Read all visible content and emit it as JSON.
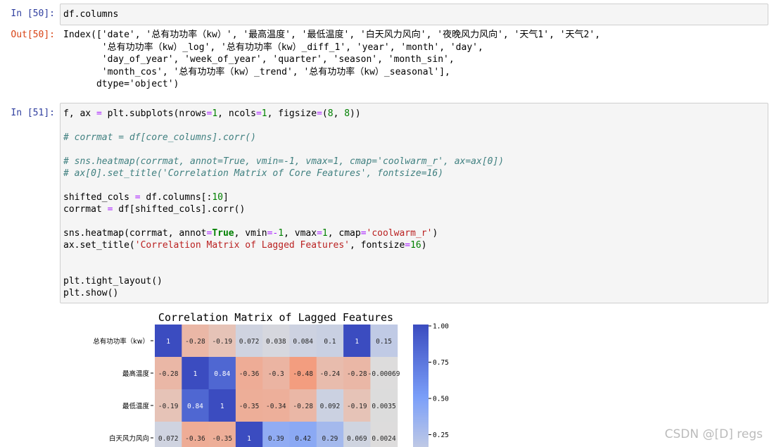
{
  "cells": [
    {
      "prompt": "In  [50]:",
      "code": [
        [
          [
            "df.columns",
            ""
          ]
        ]
      ]
    },
    {
      "prompt": "Out[50]:",
      "output": [
        "Index(['date', '总有功功率（kw）', '最高温度', '最低温度', '白天风力风向', '夜晚风力风向', '天气1', '天气2',",
        "       '总有功功率（kw）_log', '总有功功率（kw）_diff_1', 'year', 'month', 'day',",
        "       'day_of_year', 'week_of_year', 'quarter', 'season', 'month_sin',",
        "       'month_cos', '总有功功率（kw）_trend', '总有功功率（kw）_seasonal'],",
        "      dtype='object')"
      ]
    },
    {
      "prompt": "In  [51]:",
      "code": [
        [
          [
            "f, ax ",
            ""
          ],
          [
            "=",
            "op"
          ],
          [
            " plt.subplots(nrows",
            ""
          ],
          [
            "=",
            "op"
          ],
          [
            "1",
            "num"
          ],
          [
            ", ncols",
            ""
          ],
          [
            "=",
            "op"
          ],
          [
            "1",
            "num"
          ],
          [
            ", figsize",
            ""
          ],
          [
            "=",
            "op"
          ],
          [
            "(",
            ""
          ],
          [
            "8",
            "num"
          ],
          [
            ", ",
            ""
          ],
          [
            "8",
            "num"
          ],
          [
            "))",
            ""
          ]
        ],
        [],
        [
          [
            "# corrmat = df[core_columns].corr()",
            "cm"
          ]
        ],
        [],
        [
          [
            "# sns.heatmap(corrmat, annot=True, vmin=-1, vmax=1, cmap='coolwarm_r', ax=ax[0])",
            "cm"
          ]
        ],
        [
          [
            "# ax[0].set_title('Correlation Matrix of Core Features', fontsize=16)",
            "cm"
          ]
        ],
        [],
        [
          [
            "shifted_cols ",
            ""
          ],
          [
            "=",
            "op"
          ],
          [
            " df.columns[:",
            ""
          ],
          [
            "10",
            "num"
          ],
          [
            "]",
            ""
          ]
        ],
        [
          [
            "corrmat ",
            ""
          ],
          [
            "=",
            "op"
          ],
          [
            " df[shifted_cols].corr()",
            ""
          ]
        ],
        [],
        [
          [
            "sns.heatmap(corrmat, annot",
            ""
          ],
          [
            "=",
            "op"
          ],
          [
            "True",
            "kw"
          ],
          [
            ", vmin",
            ""
          ],
          [
            "=-",
            "op"
          ],
          [
            "1",
            "num"
          ],
          [
            ", vmax",
            ""
          ],
          [
            "=",
            "op"
          ],
          [
            "1",
            "num"
          ],
          [
            ", cmap",
            ""
          ],
          [
            "=",
            "op"
          ],
          [
            "'coolwarm_r'",
            "str"
          ],
          [
            ")",
            ""
          ]
        ],
        [
          [
            "ax.set_title(",
            ""
          ],
          [
            "'Correlation Matrix of Lagged Features'",
            "str"
          ],
          [
            ", fontsize",
            ""
          ],
          [
            "=",
            "op"
          ],
          [
            "16",
            "num"
          ],
          [
            ")",
            ""
          ]
        ],
        [],
        [],
        [
          [
            "plt.tight_layout()",
            ""
          ]
        ],
        [
          [
            "plt.show()",
            ""
          ]
        ]
      ]
    }
  ],
  "chart_data": {
    "type": "heatmap",
    "title": "Correlation Matrix of Lagged Features",
    "row_labels": [
      "总有功功率（kw）",
      "最高温度",
      "最低温度",
      "白天风力风向"
    ],
    "values": [
      [
        1,
        -0.28,
        -0.19,
        0.072,
        0.038,
        0.084,
        0.1,
        1,
        0.15
      ],
      [
        -0.28,
        1,
        0.84,
        -0.36,
        -0.3,
        -0.48,
        -0.24,
        -0.28,
        -0.00069
      ],
      [
        -0.19,
        0.84,
        1,
        -0.35,
        -0.34,
        -0.28,
        0.092,
        -0.19,
        0.0035
      ],
      [
        0.072,
        -0.36,
        -0.35,
        1,
        0.39,
        0.42,
        0.29,
        0.069,
        0.0024
      ]
    ],
    "vmin": -1,
    "vmax": 1,
    "cmap": "coolwarm_r",
    "colorbar_ticks": [
      "1.00",
      "0.75",
      "0.50",
      "0.25"
    ]
  },
  "watermark": "CSDN @[D] regs"
}
